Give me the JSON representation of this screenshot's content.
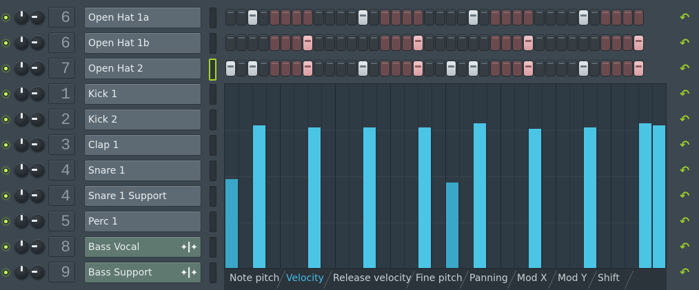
{
  "channels": [
    {
      "num": "6",
      "name": "Open Hat 1a",
      "audio": false,
      "selected": false,
      "steps": [
        "d",
        "d",
        "w",
        "d",
        "r",
        "r",
        "r",
        "r",
        "d",
        "d",
        "d",
        "d",
        "w",
        "d",
        "r",
        "r",
        "r",
        "r",
        "d",
        "d",
        "d",
        "d",
        "w",
        "d",
        "r",
        "r",
        "r",
        "r",
        "d",
        "d",
        "d",
        "d",
        "w",
        "d",
        "r",
        "r",
        "r",
        "r"
      ]
    },
    {
      "num": "6",
      "name": "Open Hat 1b",
      "audio": false,
      "selected": false,
      "steps": [
        "d",
        "d",
        "d",
        "d",
        "r",
        "r",
        "r",
        "p",
        "d",
        "d",
        "d",
        "d",
        "d",
        "d",
        "r",
        "r",
        "r",
        "p",
        "d",
        "d",
        "d",
        "d",
        "d",
        "d",
        "r",
        "r",
        "r",
        "p",
        "d",
        "d",
        "d",
        "d",
        "d",
        "d",
        "r",
        "r",
        "r",
        "p"
      ]
    },
    {
      "num": "7",
      "name": "Open Hat 2",
      "audio": false,
      "selected": true,
      "steps": [
        "w",
        "d",
        "w",
        "d",
        "r",
        "r",
        "r",
        "p",
        "d",
        "d",
        "d",
        "d",
        "w",
        "d",
        "r",
        "r",
        "r",
        "p",
        "d",
        "d",
        "w",
        "d",
        "w",
        "d",
        "r",
        "r",
        "r",
        "p",
        "d",
        "d",
        "d",
        "d",
        "w",
        "d",
        "r",
        "r",
        "r",
        "p"
      ]
    },
    {
      "num": "1",
      "name": "Kick 1",
      "audio": false,
      "selected": false
    },
    {
      "num": "2",
      "name": "Kick 2",
      "audio": false,
      "selected": false
    },
    {
      "num": "3",
      "name": "Clap 1",
      "audio": false,
      "selected": false
    },
    {
      "num": "4",
      "name": "Snare 1",
      "audio": false,
      "selected": false
    },
    {
      "num": "4",
      "name": "Snare 1 Support",
      "audio": false,
      "selected": false
    },
    {
      "num": "5",
      "name": "Perc 1",
      "audio": false,
      "selected": false
    },
    {
      "num": "8",
      "name": "Bass Vocal",
      "audio": true,
      "selected": false
    },
    {
      "num": "9",
      "name": "Bass Support",
      "audio": true,
      "selected": false
    }
  ],
  "wave_icon": "waveform-icon",
  "undo_icon": "undo-arrow-icon",
  "event_graph": {
    "steps": 32,
    "velocity_levels": [
      0.48,
      0,
      0.77,
      0,
      0,
      0,
      0.76,
      0,
      0,
      0,
      0.76,
      0,
      0,
      0,
      0.76,
      0,
      0.46,
      0,
      0.78,
      0,
      0,
      0,
      0.75,
      0,
      0,
      0,
      0.76,
      0,
      0,
      0,
      0.78,
      0.77
    ],
    "dim_steps": [
      0,
      16
    ]
  },
  "param_tabs": [
    "Note pitch",
    "Velocity",
    "Release velocity",
    "Fine pitch",
    "Panning",
    "Mod X",
    "Mod Y",
    "Shift"
  ],
  "active_tab": "Velocity",
  "colors": {
    "accent_green": "#b4ec3a",
    "velocity_bar": "#4bc5e6",
    "active_tab": "#46b9e8",
    "step_pink": "#f4c6c8",
    "step_red": "#6b4a4d"
  }
}
